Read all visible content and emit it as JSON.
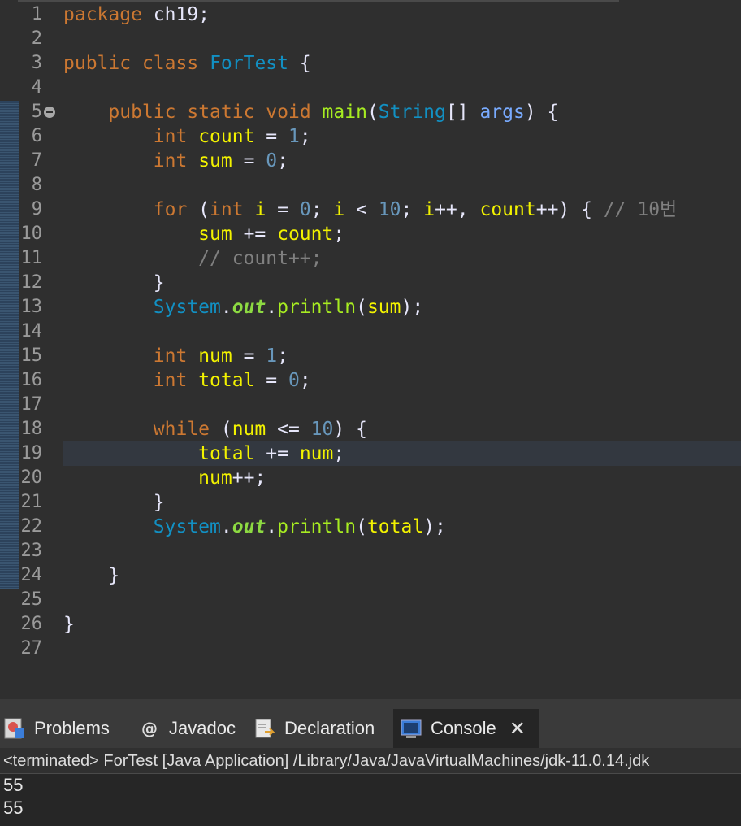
{
  "editor": {
    "lines": [
      {
        "n": "1",
        "tokens": [
          [
            "kw",
            "package"
          ],
          [
            "punct",
            " ch19;"
          ]
        ]
      },
      {
        "n": "2",
        "tokens": []
      },
      {
        "n": "3",
        "tokens": [
          [
            "kw",
            "public"
          ],
          [
            "punct",
            " "
          ],
          [
            "kw",
            "class"
          ],
          [
            "punct",
            " "
          ],
          [
            "cls",
            "ForTest"
          ],
          [
            "punct",
            " {"
          ]
        ]
      },
      {
        "n": "4",
        "tokens": []
      },
      {
        "n": "5",
        "tokens": [
          [
            "punct",
            "    "
          ],
          [
            "kw",
            "public"
          ],
          [
            "punct",
            " "
          ],
          [
            "kw",
            "static"
          ],
          [
            "punct",
            " "
          ],
          [
            "kw",
            "void"
          ],
          [
            "punct",
            " "
          ],
          [
            "fn",
            "main"
          ],
          [
            "punct",
            "("
          ],
          [
            "cls",
            "String"
          ],
          [
            "punct",
            "[] "
          ],
          [
            "param",
            "args"
          ],
          [
            "punct",
            ") {"
          ]
        ]
      },
      {
        "n": "6",
        "tokens": [
          [
            "punct",
            "        "
          ],
          [
            "kw",
            "int"
          ],
          [
            "punct",
            " "
          ],
          [
            "var",
            "count"
          ],
          [
            "punct",
            " = "
          ],
          [
            "num",
            "1"
          ],
          [
            "punct",
            ";"
          ]
        ]
      },
      {
        "n": "7",
        "tokens": [
          [
            "punct",
            "        "
          ],
          [
            "kw",
            "int"
          ],
          [
            "punct",
            " "
          ],
          [
            "var",
            "sum"
          ],
          [
            "punct",
            " = "
          ],
          [
            "num",
            "0"
          ],
          [
            "punct",
            ";"
          ]
        ]
      },
      {
        "n": "8",
        "tokens": []
      },
      {
        "n": "9",
        "tokens": [
          [
            "punct",
            "        "
          ],
          [
            "kw",
            "for"
          ],
          [
            "punct",
            " ("
          ],
          [
            "kw",
            "int"
          ],
          [
            "punct",
            " "
          ],
          [
            "var",
            "i"
          ],
          [
            "punct",
            " = "
          ],
          [
            "num",
            "0"
          ],
          [
            "punct",
            "; "
          ],
          [
            "var",
            "i"
          ],
          [
            "punct",
            " < "
          ],
          [
            "num",
            "10"
          ],
          [
            "punct",
            "; "
          ],
          [
            "var",
            "i"
          ],
          [
            "punct",
            "++, "
          ],
          [
            "var",
            "count"
          ],
          [
            "punct",
            "++) { "
          ],
          [
            "cmt",
            "// 10번"
          ]
        ]
      },
      {
        "n": "10",
        "tokens": [
          [
            "punct",
            "            "
          ],
          [
            "var",
            "sum"
          ],
          [
            "punct",
            " += "
          ],
          [
            "var",
            "count"
          ],
          [
            "punct",
            ";"
          ]
        ]
      },
      {
        "n": "11",
        "tokens": [
          [
            "punct",
            "            "
          ],
          [
            "cmt",
            "// count++;"
          ]
        ]
      },
      {
        "n": "12",
        "tokens": [
          [
            "punct",
            "        }"
          ]
        ]
      },
      {
        "n": "13",
        "tokens": [
          [
            "punct",
            "        "
          ],
          [
            "cls",
            "System"
          ],
          [
            "punct",
            "."
          ],
          [
            "fld",
            "out"
          ],
          [
            "punct",
            "."
          ],
          [
            "fn",
            "println"
          ],
          [
            "punct",
            "("
          ],
          [
            "var",
            "sum"
          ],
          [
            "punct",
            ");"
          ]
        ]
      },
      {
        "n": "14",
        "tokens": []
      },
      {
        "n": "15",
        "tokens": [
          [
            "punct",
            "        "
          ],
          [
            "kw",
            "int"
          ],
          [
            "punct",
            " "
          ],
          [
            "var",
            "num"
          ],
          [
            "punct",
            " = "
          ],
          [
            "num",
            "1"
          ],
          [
            "punct",
            ";"
          ]
        ]
      },
      {
        "n": "16",
        "tokens": [
          [
            "punct",
            "        "
          ],
          [
            "kw",
            "int"
          ],
          [
            "punct",
            " "
          ],
          [
            "var",
            "total"
          ],
          [
            "punct",
            " = "
          ],
          [
            "num",
            "0"
          ],
          [
            "punct",
            ";"
          ]
        ]
      },
      {
        "n": "17",
        "tokens": []
      },
      {
        "n": "18",
        "tokens": [
          [
            "punct",
            "        "
          ],
          [
            "kw",
            "while"
          ],
          [
            "punct",
            " ("
          ],
          [
            "var",
            "num"
          ],
          [
            "punct",
            " <= "
          ],
          [
            "num",
            "10"
          ],
          [
            "punct",
            ") {"
          ]
        ]
      },
      {
        "n": "19",
        "tokens": [
          [
            "punct",
            "            "
          ],
          [
            "var",
            "total"
          ],
          [
            "punct",
            " += "
          ],
          [
            "var",
            "num"
          ],
          [
            "punct",
            ";"
          ]
        ]
      },
      {
        "n": "20",
        "tokens": [
          [
            "punct",
            "            "
          ],
          [
            "var",
            "num"
          ],
          [
            "punct",
            "++;"
          ]
        ]
      },
      {
        "n": "21",
        "tokens": [
          [
            "punct",
            "        }"
          ]
        ]
      },
      {
        "n": "22",
        "tokens": [
          [
            "punct",
            "        "
          ],
          [
            "cls",
            "System"
          ],
          [
            "punct",
            "."
          ],
          [
            "fld",
            "out"
          ],
          [
            "punct",
            "."
          ],
          [
            "fn",
            "println"
          ],
          [
            "punct",
            "("
          ],
          [
            "var",
            "total"
          ],
          [
            "punct",
            ");"
          ]
        ]
      },
      {
        "n": "23",
        "tokens": []
      },
      {
        "n": "24",
        "tokens": [
          [
            "punct",
            "    }"
          ]
        ]
      },
      {
        "n": "25",
        "tokens": []
      },
      {
        "n": "26",
        "tokens": [
          [
            "punct",
            "}"
          ]
        ]
      },
      {
        "n": "27",
        "tokens": []
      }
    ],
    "current_line": "19",
    "fold_line": "5"
  },
  "panel": {
    "tabs": [
      {
        "label": "Problems",
        "icon": "problems-icon",
        "active": false
      },
      {
        "label": "Javadoc",
        "icon": "javadoc-icon",
        "active": false
      },
      {
        "label": "Declaration",
        "icon": "declaration-icon",
        "active": false
      },
      {
        "label": "Console",
        "icon": "console-icon",
        "active": true
      }
    ],
    "console_header": "<terminated> ForTest [Java Application] /Library/Java/JavaVirtualMachines/jdk-11.0.14.jdk",
    "output": [
      "55",
      "55"
    ]
  }
}
